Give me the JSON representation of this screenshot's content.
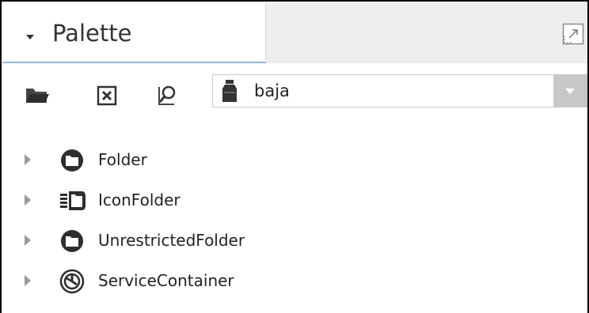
{
  "palette": {
    "title": "Palette"
  },
  "toolbar": {
    "icons": [
      "open-folder-icon",
      "close-palette-icon",
      "find-icon"
    ]
  },
  "module_select": {
    "value": "baja",
    "icon": "jar-icon"
  },
  "tree": {
    "items": [
      {
        "label": "Folder",
        "icon": "folder-icon"
      },
      {
        "label": "IconFolder",
        "icon": "icon-folder-icon"
      },
      {
        "label": "UnrestrictedFolder",
        "icon": "folder-icon"
      },
      {
        "label": "ServiceContainer",
        "icon": "service-container-icon"
      }
    ]
  }
}
